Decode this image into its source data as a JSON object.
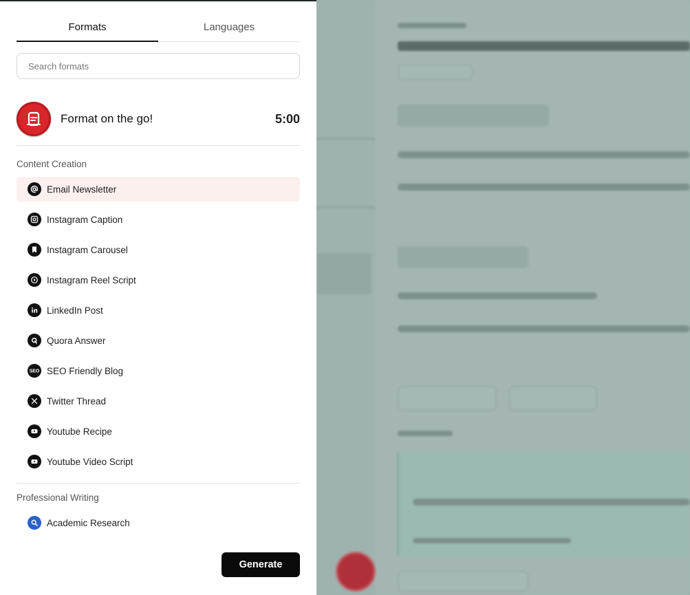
{
  "tabs": {
    "formats": "Formats",
    "languages": "Languages"
  },
  "search": {
    "placeholder": "Search formats"
  },
  "on_the_go": {
    "title": "Format on the go!",
    "time": "5:00"
  },
  "sections": {
    "content_creation": "Content Creation",
    "professional_writing": "Professional Writing"
  },
  "content_items": [
    {
      "label": "Email Newsletter",
      "icon": "at-icon"
    },
    {
      "label": "Instagram Caption",
      "icon": "instagram-icon"
    },
    {
      "label": "Instagram Carousel",
      "icon": "bookmark-icon"
    },
    {
      "label": "Instagram Reel Script",
      "icon": "reel-icon"
    },
    {
      "label": "LinkedIn Post",
      "icon": "linkedin-icon"
    },
    {
      "label": "Quora Answer",
      "icon": "quora-icon"
    },
    {
      "label": "SEO Friendly Blog",
      "icon": "seo-icon"
    },
    {
      "label": "Twitter Thread",
      "icon": "x-icon"
    },
    {
      "label": "Youtube Recipe",
      "icon": "youtube-icon"
    },
    {
      "label": "Youtube Video Script",
      "icon": "youtube-icon"
    }
  ],
  "professional_items": [
    {
      "label": "Academic Research",
      "icon": "search-icon"
    }
  ],
  "generate_label": "Generate",
  "colors": {
    "accent_red": "#d8262b",
    "selected_bg": "#fcf0ef",
    "button_bg": "#0a0a0a"
  }
}
